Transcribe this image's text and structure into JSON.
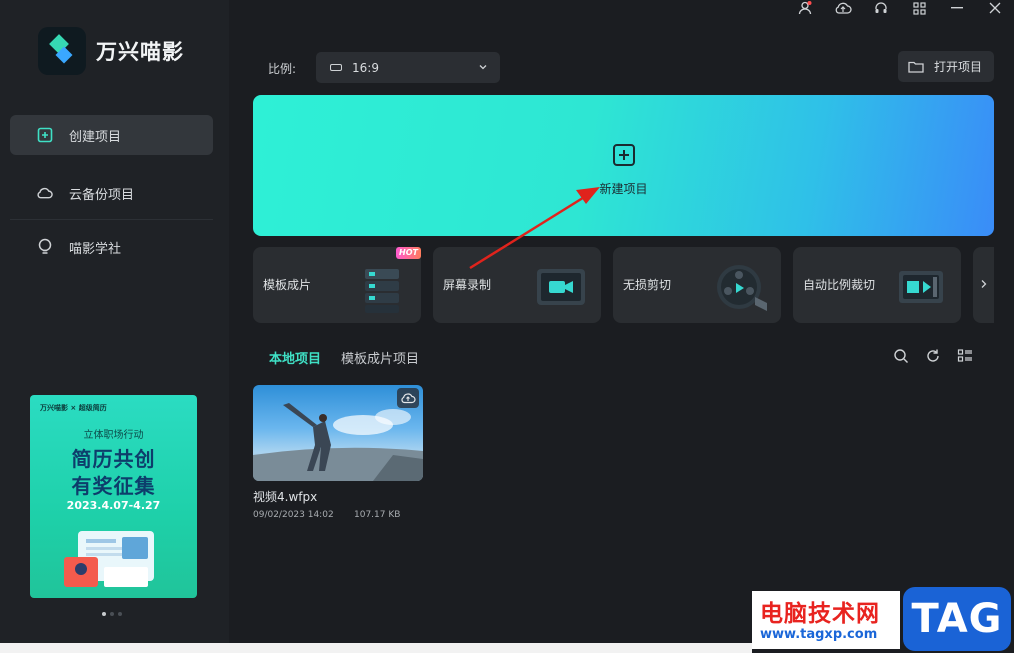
{
  "app": {
    "name": "万兴喵影"
  },
  "sidebar": {
    "items": [
      {
        "label": "创建项目",
        "icon": "plus-square-icon"
      },
      {
        "label": "云备份项目",
        "icon": "cloud-icon"
      },
      {
        "label": "喵影学社",
        "icon": "bulb-icon"
      }
    ],
    "banner": {
      "brand": "万兴喵影 × 超级简历",
      "subtitle": "立体职场行动",
      "title_line1": "简历共创",
      "title_line2": "有奖征集",
      "date": "2023.4.07-4.27"
    }
  },
  "toolbar": {
    "ratio_label": "比例:",
    "ratio_value": "16:9",
    "open_project": "打开项目"
  },
  "new_project": {
    "label": "新建项目"
  },
  "features": [
    {
      "label": "模板成片",
      "badge": "HOT"
    },
    {
      "label": "屏幕录制"
    },
    {
      "label": "无损剪切"
    },
    {
      "label": "自动比例裁切"
    }
  ],
  "tabs": [
    {
      "label": "本地项目",
      "active": true
    },
    {
      "label": "模板成片项目",
      "active": false
    }
  ],
  "projects": [
    {
      "name": "视频4.wfpx",
      "date": "09/02/2023 14:02",
      "size": "107.17 KB"
    }
  ],
  "watermark": {
    "text": "电脑技术网",
    "url": "www.tagxp.com",
    "tag": "TAG"
  },
  "colors": {
    "accent": "#3fe0c5",
    "banner_start": "#2ef0d6",
    "banner_end": "#3a8cf8",
    "arrow": "#e0231c"
  }
}
